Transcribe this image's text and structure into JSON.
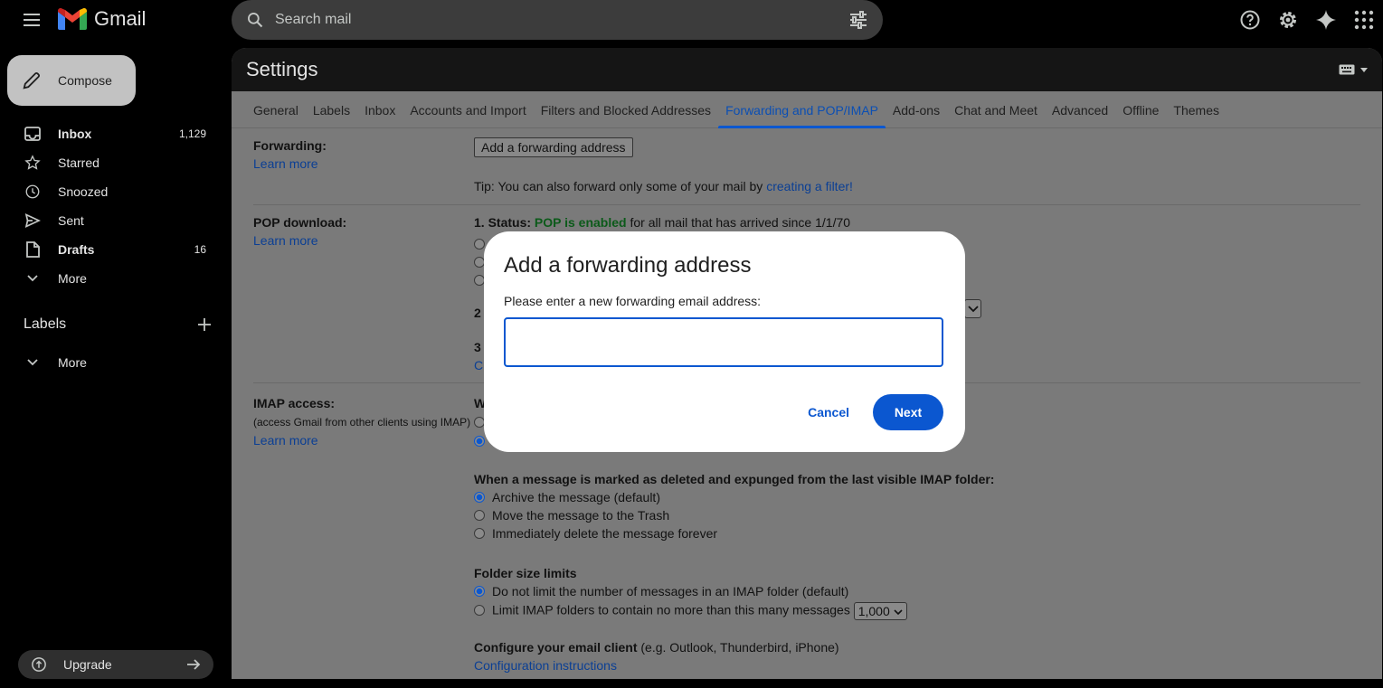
{
  "app": {
    "name": "Gmail"
  },
  "search": {
    "placeholder": "Search mail"
  },
  "icons": {
    "help": "help-icon",
    "settings": "gear-icon",
    "gemini": "sparkle-icon",
    "apps": "apps-grid-icon"
  },
  "sidebar": {
    "compose": "Compose",
    "items": [
      {
        "label": "Inbox",
        "count": "1,129"
      },
      {
        "label": "Starred",
        "count": ""
      },
      {
        "label": "Snoozed",
        "count": ""
      },
      {
        "label": "Sent",
        "count": ""
      },
      {
        "label": "Drafts",
        "count": "16"
      },
      {
        "label": "More",
        "count": ""
      }
    ],
    "labels_title": "Labels",
    "labels_more": "More",
    "upgrade": "Upgrade"
  },
  "settings": {
    "title": "Settings",
    "tabs": [
      "General",
      "Labels",
      "Inbox",
      "Accounts and Import",
      "Filters and Blocked Addresses",
      "Forwarding and POP/IMAP",
      "Add-ons",
      "Chat and Meet",
      "Advanced",
      "Offline",
      "Themes"
    ],
    "active_tab": "Forwarding and POP/IMAP",
    "forwarding": {
      "label": "Forwarding:",
      "learn_more": "Learn more",
      "button": "Add a forwarding address",
      "tip_prefix": "Tip: You can also forward only some of your mail by ",
      "tip_link": "creating a filter!"
    },
    "pop": {
      "label": "POP download:",
      "learn_more": "Learn more",
      "status_prefix": "1. Status: ",
      "status_value": "POP is enabled",
      "status_suffix": " for all mail that has arrived since 1/1/70",
      "row2": "2",
      "row3": "3",
      "row3_link": "C"
    },
    "imap": {
      "label": "IMAP access:",
      "sub": "(access Gmail from other clients using IMAP)",
      "learn_more": "Learn more",
      "status_partial": "W",
      "deleted_title": "When a message is marked as deleted and expunged from the last visible IMAP folder:",
      "deleted_options": [
        "Archive the message (default)",
        "Move the message to the Trash",
        "Immediately delete the message forever"
      ],
      "folder_title": "Folder size limits",
      "folder_options": [
        "Do not limit the number of messages in an IMAP folder (default)",
        "Limit IMAP folders to contain no more than this many messages"
      ],
      "folder_limit_value": "1,000",
      "configure_title": "Configure your email client",
      "configure_hint": " (e.g. Outlook, Thunderbird, iPhone)",
      "configure_link": "Configuration instructions"
    }
  },
  "modal": {
    "title": "Add a forwarding address",
    "prompt": "Please enter a new forwarding email address:",
    "input_value": "",
    "cancel": "Cancel",
    "next": "Next"
  },
  "colors": {
    "accent": "#0b57d0",
    "pop_enabled": "#0c5a1a"
  }
}
